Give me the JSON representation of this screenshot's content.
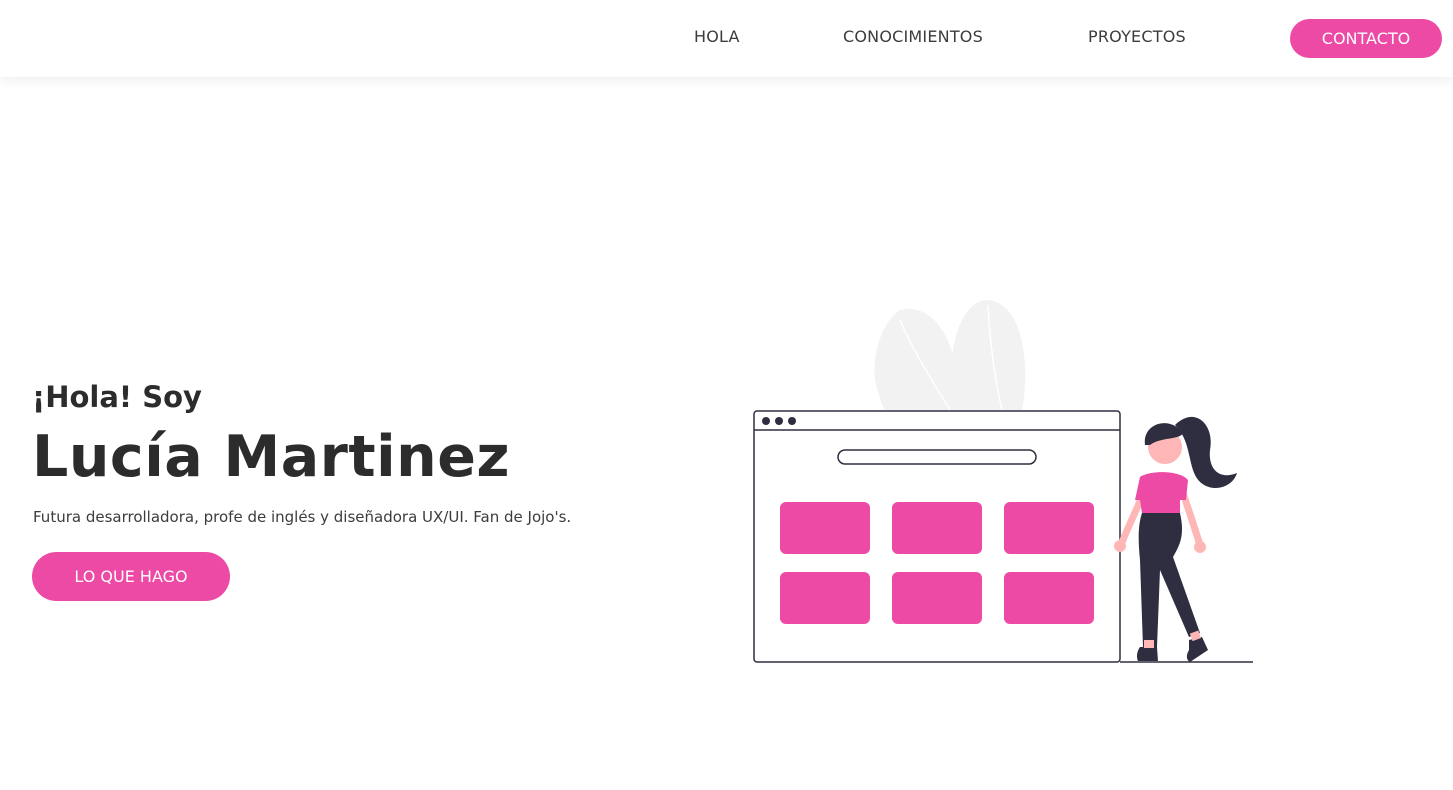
{
  "nav": {
    "items": [
      {
        "label": "HOLA"
      },
      {
        "label": "CONOCIMIENTOS"
      },
      {
        "label": "PROYECTOS"
      }
    ],
    "contact_label": "CONTACTO"
  },
  "hero": {
    "greeting": "¡Hola! Soy",
    "name": "Lucía Martinez",
    "tagline": "Futura desarrolladora, profe de inglés y diseñadora UX/UI. Fan de Jojo's.",
    "cta_label": "LO QUE HAGO"
  },
  "colors": {
    "accent": "#ec4aa5",
    "text": "#2c2c2c",
    "illustration_outline": "#2f2e41",
    "leaf": "#f2f2f2",
    "skin": "#ffb6b6"
  },
  "illustration": {
    "icons": [
      "browser-window-illustration",
      "woman-figure-illustration",
      "leaf-plant-illustration"
    ]
  }
}
